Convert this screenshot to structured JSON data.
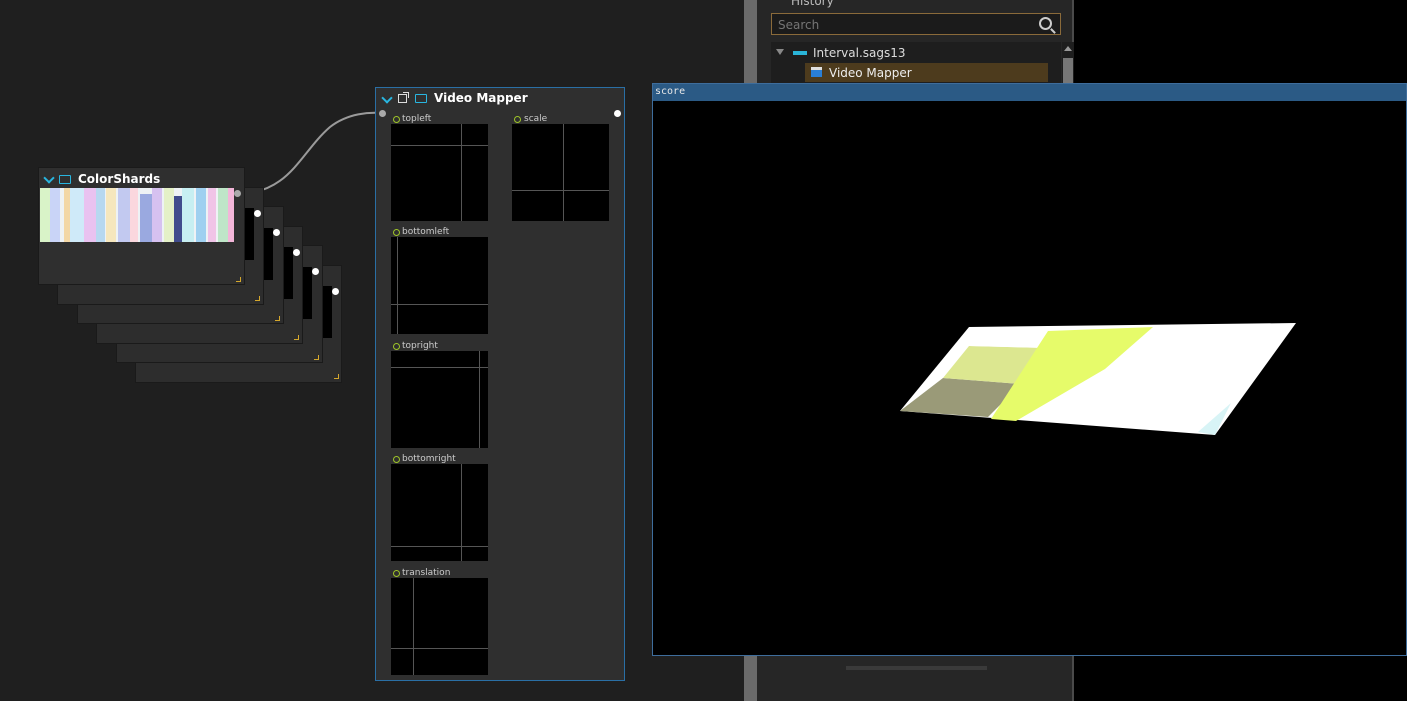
{
  "dock": {
    "history_title": "History",
    "search_placeholder": "Search",
    "tree": {
      "root_label": "Interval.sags13",
      "child_label": "Video Mapper"
    }
  },
  "colorshards": {
    "title": "ColorShards"
  },
  "video_mapper": {
    "title": "Video Mapper",
    "params": [
      "topleft",
      "scale",
      "bottomleft",
      "topright",
      "bottomright",
      "translation"
    ]
  },
  "score": {
    "title": "score"
  },
  "colors": {
    "accent": "#29b6e0",
    "port_green": "#9ec528",
    "selection": "#4d3b1d",
    "window_border": "#3e6d9c"
  }
}
